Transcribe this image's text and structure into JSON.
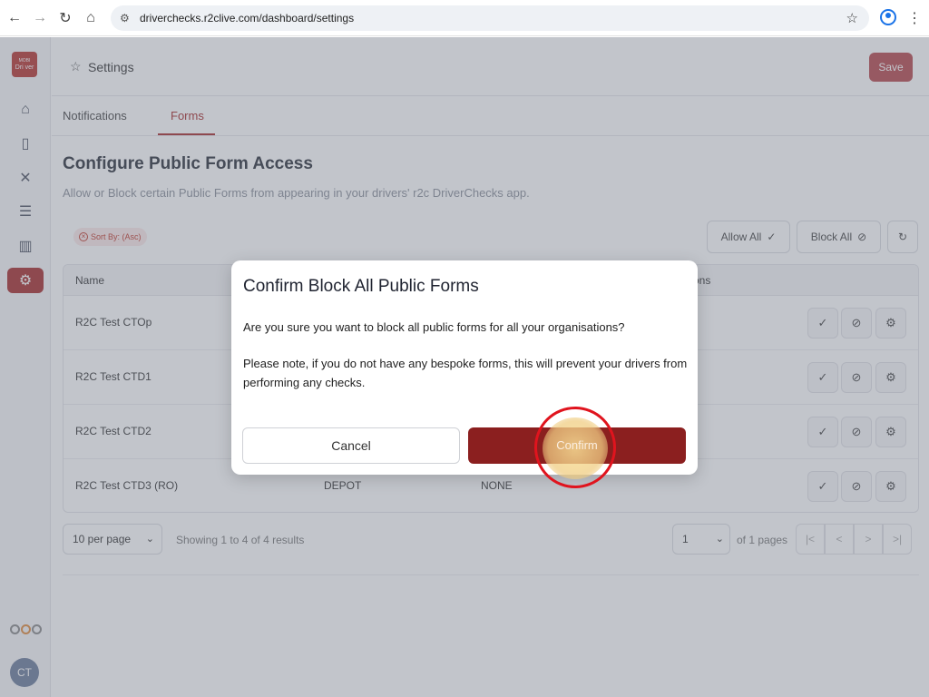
{
  "browser": {
    "url": "driverchecks.r2clive.com/dashboard/settings"
  },
  "sidebar": {
    "logo": {
      "line1": "MOBI",
      "line2": "Dri ver"
    },
    "items": [
      {
        "icon": "home-icon",
        "glyph": "⌂"
      },
      {
        "icon": "clipboard-icon",
        "glyph": "📋"
      },
      {
        "icon": "tools-icon",
        "glyph": "✕"
      },
      {
        "icon": "list-icon",
        "glyph": "☰"
      },
      {
        "icon": "chart-icon",
        "glyph": "▥"
      },
      {
        "icon": "gear-icon",
        "glyph": "⚙"
      }
    ],
    "avatar": "CT"
  },
  "header": {
    "title": "Settings",
    "save_label": "Save"
  },
  "tabs": [
    {
      "label": "Notifications"
    },
    {
      "label": "Forms"
    }
  ],
  "content": {
    "heading": "Configure Public Form Access",
    "subheading": "Allow or Block certain Public Forms from appearing in your drivers' r2c DriverChecks app.",
    "sort_chip": "Sort By: (Asc)",
    "allow_all": "Allow All",
    "block_all": "Block All"
  },
  "table": {
    "columns": [
      "Name",
      "ons"
    ],
    "rows": [
      {
        "name": "R2C Test CTOp",
        "col2": "",
        "col3": ""
      },
      {
        "name": "R2C Test CTD1",
        "col2": "",
        "col3": ""
      },
      {
        "name": "R2C Test CTD2",
        "col2": "",
        "col3": ""
      },
      {
        "name": "R2C Test CTD3 (RO)",
        "col2": "DEPOT",
        "col3": "NONE"
      }
    ]
  },
  "pager": {
    "per_page": "10 per page",
    "showing": "Showing 1 to 4 of 4 results",
    "page": "1",
    "of_pages": "of 1 pages"
  },
  "modal": {
    "title": "Confirm Block All Public Forms",
    "text1": "Are you sure you want to block all public forms for all your organisations?",
    "text2": "Please note, if you do not have any bespoke forms, this will prevent your drivers from performing any checks.",
    "cancel": "Cancel",
    "confirm": "Confirm"
  },
  "colors": {
    "brand": "#a52a2a",
    "confirm_bg": "#8b1f1f",
    "click_ring": "#e0141e"
  }
}
